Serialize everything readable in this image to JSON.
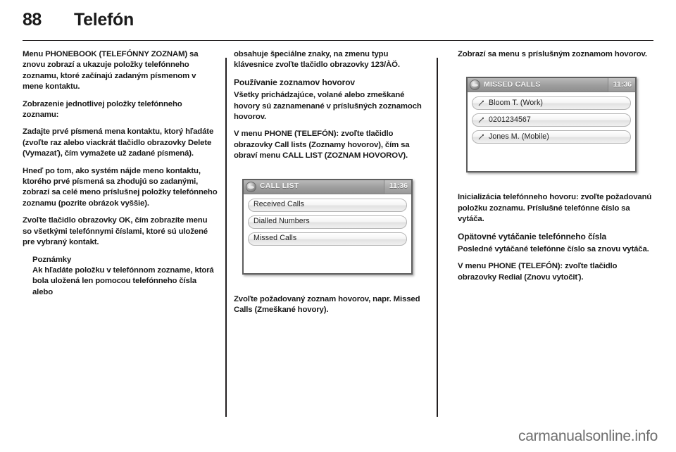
{
  "header": {
    "page_number": "88",
    "title": "Telefón"
  },
  "column1": {
    "p1": "Menu PHONEBOOK (TELEFÓNNY ZOZNAM) sa znovu zobrazí a ukazuje položky telefónneho zoznamu, ktoré začínajú zadaným písmenom v mene kontaktu.",
    "p2": "Zobrazenie jednotlivej položky telefónneho zoznamu:",
    "p3": "Zadajte prvé písmená mena kontaktu, ktorý hľadáte (zvoľte raz alebo viackrát tlačidlo obrazovky Delete (Vymazať), čím vymažete už zadané písmená).",
    "p4": "Hneď po tom, ako systém nájde meno kontaktu, ktorého prvé písmená sa zhodujú so zadanými, zobrazí sa celé meno príslušnej položky telefónneho zoznamu (pozrite obrázok vyššie).",
    "p5": "Zvoľte tlačidlo obrazovky OK, čím zobrazíte menu so všetkými telefónnymi číslami, ktoré sú uložené pre vybraný kontakt.",
    "note_title": "Poznámky",
    "note_body": "Ak hľadáte položku v telefónnom zozname, ktorá bola uložená len pomocou telefónneho čísla alebo"
  },
  "column2": {
    "p1": "obsahuje špeciálne znaky, na zmenu typu klávesnice zvoľte tlačidlo obrazovky 123/ÀÖ.",
    "heading": "Používanie zoznamov hovorov",
    "p2": "Všetky prichádzajúce, volané alebo zmeškané hovory sú zaznamenané v príslušných zoznamoch hovorov.",
    "p3": "V menu PHONE (TELEFÓN): zvoľte tlačidlo obrazovky Call lists (Zoznamy hovorov), čím sa obraví menu CALL LIST (ZOZNAM HOVOROV).",
    "p4": "Zvoľte požadovaný zoznam hovorov, napr. Missed Calls (Zmeškané hovory).",
    "screenshot": {
      "title": "CALL LIST",
      "clock": "11:36",
      "globe_icon": "globe-icon",
      "items": [
        {
          "label": "Received Calls",
          "icon": ""
        },
        {
          "label": "Dialled Numbers",
          "icon": ""
        },
        {
          "label": "Missed Calls",
          "icon": ""
        }
      ]
    }
  },
  "column3": {
    "p1": "Zobrazí sa menu s príslušným zoznamom hovorov.",
    "p2": "Inicializácia telefónneho hovoru: zvoľte požadovanú položku zoznamu. Príslušné telefónne číslo sa vytáča.",
    "heading": "Opätovné vytáčanie telefónneho čísla",
    "p3": "Posledné vytáčané telefónne číslo sa znovu vytáča.",
    "p4": "V menu PHONE (TELEFÓN): zvoľte tlačidlo obrazovky Redial (Znovu vytočiť).",
    "screenshot": {
      "title": "MISSED CALLS",
      "clock": "11:36",
      "globe_icon": "globe-icon",
      "items": [
        {
          "label": "Bloom T. (Work)",
          "icon": "missed-call-arrow-icon"
        },
        {
          "label": "0201234567",
          "icon": "missed-call-arrow-icon"
        },
        {
          "label": "Jones M. (Mobile)",
          "icon": "missed-call-arrow-icon"
        }
      ]
    }
  },
  "footer": {
    "watermark": "carmanualsonline.info"
  },
  "colors": {
    "ink": "#231f20",
    "watermark": "#6e6e6e",
    "titlebar": "#9d9d9d"
  }
}
